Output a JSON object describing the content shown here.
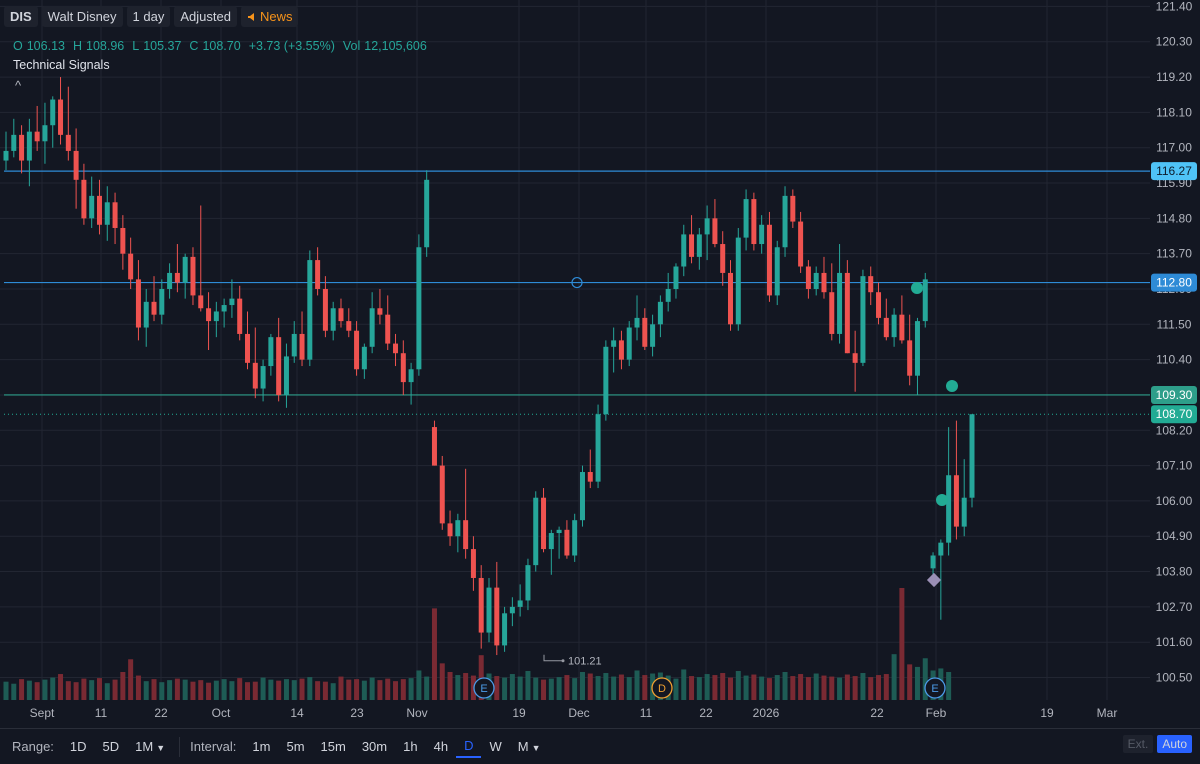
{
  "header": {
    "symbol": "DIS",
    "name": "Walt Disney",
    "interval": "1 day",
    "adjusted": "Adjusted",
    "news": "News",
    "ohlc": [
      {
        "k": "O",
        "v": "106.13"
      },
      {
        "k": "H",
        "v": "108.96"
      },
      {
        "k": "L",
        "v": "105.37"
      },
      {
        "k": "C",
        "v": "108.70"
      },
      {
        "k": "",
        "v": "+3.73 (+3.55%)"
      },
      {
        "k": "Vol",
        "v": "12,105,606"
      }
    ],
    "technical_signals": "Technical Signals",
    "collapse": "^"
  },
  "colors": {
    "up": "#26a69a",
    "down": "#ef5350",
    "bg": "#131722",
    "grid": "#222632",
    "level": "#2e8bd6",
    "last": "#22ab94"
  },
  "chart_data": {
    "type": "candlestick",
    "ylim": [
      99.8,
      121.6
    ],
    "y_ticks": [
      "121.40",
      "120.30",
      "119.20",
      "118.10",
      "117.00",
      "115.90",
      "114.80",
      "113.70",
      "112.60",
      "111.50",
      "110.40",
      "109.30",
      "108.20",
      "107.10",
      "106.00",
      "104.90",
      "103.80",
      "102.70",
      "101.60",
      "100.50"
    ],
    "x_ticks": [
      "Sept",
      "11",
      "22",
      "Oct",
      "14",
      "23",
      "Nov",
      "19",
      "Dec",
      "11",
      "22",
      "2026",
      "22",
      "Feb",
      "19",
      "Mar"
    ],
    "horizontal_levels": [
      116.27,
      112.8,
      109.3
    ],
    "level_labels": [
      "116.27",
      "112.80",
      "109.30"
    ],
    "last_price": 108.7,
    "last_price_label": "108.70",
    "low_annotation": "101.21",
    "low_value": 101.21,
    "event_markers": [
      "E",
      "D",
      "E"
    ],
    "series": [
      {
        "name": "",
        "values": [
          [
            116.6,
            117.5,
            116.3,
            116.9
          ],
          [
            116.9,
            117.9,
            116.7,
            117.4
          ],
          [
            117.4,
            117.7,
            116.2,
            116.6
          ],
          [
            116.6,
            117.9,
            115.8,
            117.5
          ],
          [
            117.5,
            118.3,
            116.9,
            117.2
          ],
          [
            117.2,
            118.4,
            116.5,
            117.7
          ],
          [
            117.7,
            118.6,
            117.0,
            118.5
          ],
          [
            118.5,
            119.2,
            117.1,
            117.4
          ],
          [
            117.4,
            118.9,
            116.6,
            116.9
          ],
          [
            116.9,
            117.6,
            115.1,
            116.0
          ],
          [
            116.0,
            116.5,
            114.6,
            114.8
          ],
          [
            114.8,
            116.1,
            114.5,
            115.5
          ],
          [
            115.5,
            116.0,
            114.3,
            114.6
          ],
          [
            114.6,
            115.8,
            114.1,
            115.3
          ],
          [
            115.3,
            115.6,
            114.0,
            114.5
          ],
          [
            114.5,
            114.9,
            113.2,
            113.7
          ],
          [
            113.7,
            114.2,
            112.6,
            112.9
          ],
          [
            112.9,
            113.5,
            111.0,
            111.4
          ],
          [
            111.4,
            112.6,
            110.8,
            112.2
          ],
          [
            112.2,
            113.0,
            111.6,
            111.8
          ],
          [
            111.8,
            112.9,
            111.5,
            112.6
          ],
          [
            112.6,
            113.4,
            112.3,
            113.1
          ],
          [
            113.1,
            114.0,
            112.5,
            112.8
          ],
          [
            112.8,
            113.7,
            112.3,
            113.6
          ],
          [
            113.6,
            113.9,
            112.1,
            112.4
          ],
          [
            112.4,
            115.2,
            111.9,
            112.0
          ],
          [
            112.0,
            112.5,
            110.7,
            111.6
          ],
          [
            111.6,
            112.2,
            111.1,
            111.9
          ],
          [
            111.9,
            112.3,
            111.4,
            112.1
          ],
          [
            112.1,
            112.9,
            111.7,
            112.3
          ],
          [
            112.3,
            112.7,
            111.0,
            111.2
          ],
          [
            111.2,
            111.9,
            110.1,
            110.3
          ],
          [
            110.3,
            111.4,
            109.2,
            109.5
          ],
          [
            109.5,
            110.4,
            109.1,
            110.2
          ],
          [
            110.2,
            111.2,
            109.9,
            111.1
          ],
          [
            111.1,
            111.7,
            109.1,
            109.3
          ],
          [
            109.3,
            110.9,
            108.9,
            110.5
          ],
          [
            110.5,
            111.6,
            110.3,
            111.2
          ],
          [
            111.2,
            111.9,
            110.2,
            110.4
          ],
          [
            110.4,
            113.8,
            110.2,
            113.5
          ],
          [
            113.5,
            113.9,
            112.4,
            112.6
          ],
          [
            112.6,
            113.0,
            111.1,
            111.3
          ],
          [
            111.3,
            112.2,
            111.0,
            112.0
          ],
          [
            112.0,
            112.3,
            111.4,
            111.6
          ],
          [
            111.6,
            112.0,
            111.1,
            111.3
          ],
          [
            111.3,
            111.6,
            109.9,
            110.1
          ],
          [
            110.1,
            110.9,
            109.8,
            110.8
          ],
          [
            110.8,
            112.5,
            110.6,
            112.0
          ],
          [
            112.0,
            112.6,
            111.5,
            111.8
          ],
          [
            111.8,
            112.4,
            110.7,
            110.9
          ],
          [
            110.9,
            111.2,
            110.2,
            110.6
          ],
          [
            110.6,
            111.0,
            109.3,
            109.7
          ],
          [
            109.7,
            110.3,
            109.0,
            110.1
          ],
          [
            110.1,
            114.3,
            109.9,
            113.9
          ],
          [
            113.9,
            116.3,
            113.6,
            116.0
          ],
          [
            108.3,
            108.5,
            107.1,
            107.1
          ],
          [
            107.1,
            107.4,
            105.1,
            105.3
          ],
          [
            105.3,
            105.7,
            104.6,
            104.9
          ],
          [
            104.9,
            105.6,
            104.4,
            105.4
          ],
          [
            105.4,
            107.0,
            104.2,
            104.5
          ],
          [
            104.5,
            104.9,
            103.2,
            103.6
          ],
          [
            103.6,
            104.0,
            101.4,
            101.9
          ],
          [
            101.9,
            103.6,
            101.6,
            103.3
          ],
          [
            103.3,
            104.1,
            101.2,
            101.5
          ],
          [
            101.5,
            102.7,
            101.3,
            102.5
          ],
          [
            102.5,
            103.0,
            102.1,
            102.7
          ],
          [
            102.7,
            103.4,
            102.4,
            102.9
          ],
          [
            102.9,
            104.2,
            102.6,
            104.0
          ],
          [
            104.0,
            106.3,
            103.8,
            106.1
          ],
          [
            106.1,
            106.4,
            104.4,
            104.5
          ],
          [
            104.5,
            105.1,
            103.7,
            105.0
          ],
          [
            105.0,
            105.2,
            104.2,
            105.1
          ],
          [
            105.1,
            105.4,
            104.2,
            104.3
          ],
          [
            104.3,
            105.6,
            104.1,
            105.4
          ],
          [
            105.4,
            107.1,
            105.2,
            106.9
          ],
          [
            106.9,
            107.6,
            106.4,
            106.6
          ],
          [
            106.6,
            109.0,
            106.4,
            108.7
          ],
          [
            108.7,
            111.0,
            108.5,
            110.8
          ],
          [
            110.8,
            111.4,
            110.0,
            111.0
          ],
          [
            111.0,
            111.3,
            110.1,
            110.4
          ],
          [
            110.4,
            111.6,
            110.2,
            111.4
          ],
          [
            111.4,
            112.4,
            111.0,
            111.7
          ],
          [
            111.7,
            112.0,
            110.7,
            110.8
          ],
          [
            110.8,
            111.8,
            110.5,
            111.5
          ],
          [
            111.5,
            112.4,
            111.1,
            112.2
          ],
          [
            112.2,
            113.1,
            111.9,
            112.6
          ],
          [
            112.6,
            113.4,
            112.3,
            113.3
          ],
          [
            113.3,
            114.6,
            113.0,
            114.3
          ],
          [
            114.3,
            114.9,
            113.4,
            113.6
          ],
          [
            113.6,
            114.5,
            113.2,
            114.3
          ],
          [
            114.3,
            115.2,
            113.5,
            114.8
          ],
          [
            114.8,
            115.4,
            113.9,
            114.0
          ],
          [
            114.0,
            114.4,
            112.7,
            113.1
          ],
          [
            113.1,
            113.5,
            111.3,
            111.5
          ],
          [
            111.5,
            114.5,
            111.3,
            114.2
          ],
          [
            114.2,
            115.7,
            113.8,
            115.4
          ],
          [
            115.4,
            115.6,
            113.8,
            114.0
          ],
          [
            114.0,
            114.9,
            113.7,
            114.6
          ],
          [
            114.6,
            115.0,
            112.2,
            112.4
          ],
          [
            112.4,
            114.1,
            112.1,
            113.9
          ],
          [
            113.9,
            115.8,
            113.6,
            115.5
          ],
          [
            115.5,
            115.7,
            114.5,
            114.7
          ],
          [
            114.7,
            115.0,
            113.1,
            113.3
          ],
          [
            113.3,
            113.5,
            112.3,
            112.6
          ],
          [
            112.6,
            113.3,
            112.4,
            113.1
          ],
          [
            113.1,
            113.6,
            112.3,
            112.5
          ],
          [
            112.5,
            113.4,
            111.0,
            111.2
          ],
          [
            111.2,
            114.0,
            110.9,
            113.1
          ],
          [
            113.1,
            113.5,
            110.6,
            110.6
          ],
          [
            110.6,
            111.3,
            109.4,
            110.3
          ],
          [
            110.3,
            113.2,
            110.2,
            113.0
          ],
          [
            113.0,
            113.3,
            112.1,
            112.5
          ],
          [
            112.5,
            112.8,
            111.5,
            111.7
          ],
          [
            111.7,
            112.3,
            111.0,
            111.1
          ],
          [
            111.1,
            112.0,
            110.8,
            111.8
          ],
          [
            111.8,
            112.4,
            110.9,
            111.0
          ],
          [
            111.0,
            111.8,
            109.6,
            109.9
          ],
          [
            109.9,
            111.7,
            109.3,
            111.6
          ],
          [
            111.6,
            113.1,
            111.4,
            112.9
          ],
          [
            103.9,
            104.4,
            103.6,
            104.3
          ],
          [
            104.3,
            104.8,
            102.3,
            104.7
          ],
          [
            104.7,
            108.3,
            104.3,
            106.8
          ],
          [
            106.8,
            108.5,
            104.8,
            105.2
          ],
          [
            105.2,
            107.3,
            104.9,
            106.1
          ],
          [
            106.1,
            108.6,
            105.8,
            108.7
          ]
        ]
      },
      {
        "name": "Volume",
        "values": [
          0.36,
          0.32,
          0.41,
          0.38,
          0.35,
          0.4,
          0.44,
          0.51,
          0.37,
          0.35,
          0.42,
          0.39,
          0.43,
          0.33,
          0.4,
          0.55,
          0.8,
          0.48,
          0.37,
          0.41,
          0.35,
          0.39,
          0.42,
          0.4,
          0.36,
          0.39,
          0.34,
          0.38,
          0.41,
          0.37,
          0.43,
          0.35,
          0.36,
          0.44,
          0.4,
          0.38,
          0.41,
          0.39,
          0.42,
          0.45,
          0.37,
          0.36,
          0.33,
          0.46,
          0.4,
          0.41,
          0.38,
          0.44,
          0.39,
          0.42,
          0.37,
          0.41,
          0.43,
          0.58,
          0.46,
          1.8,
          0.72,
          0.55,
          0.49,
          0.53,
          0.48,
          0.88,
          0.52,
          0.47,
          0.44,
          0.51,
          0.46,
          0.57,
          0.44,
          0.4,
          0.42,
          0.45,
          0.49,
          0.43,
          0.55,
          0.52,
          0.47,
          0.53,
          0.46,
          0.5,
          0.45,
          0.58,
          0.49,
          0.52,
          0.54,
          0.48,
          0.42,
          0.6,
          0.47,
          0.45,
          0.51,
          0.49,
          0.53,
          0.44,
          0.57,
          0.48,
          0.5,
          0.46,
          0.43,
          0.49,
          0.55,
          0.47,
          0.51,
          0.45,
          0.52,
          0.48,
          0.46,
          0.44,
          0.5,
          0.47,
          0.53,
          0.45,
          0.49,
          0.51,
          0.9,
          2.2,
          0.7,
          0.65,
          0.82,
          0.58,
          0.62,
          0.55
        ]
      }
    ]
  },
  "bottom_bar": {
    "range_label": "Range:",
    "ranges": [
      "1D",
      "5D",
      "1M"
    ],
    "interval_label": "Interval:",
    "intervals": [
      "1m",
      "5m",
      "15m",
      "30m",
      "1h",
      "4h",
      "D",
      "W",
      "M"
    ],
    "active_interval": "D",
    "ext": "Ext.",
    "auto": "Auto"
  }
}
